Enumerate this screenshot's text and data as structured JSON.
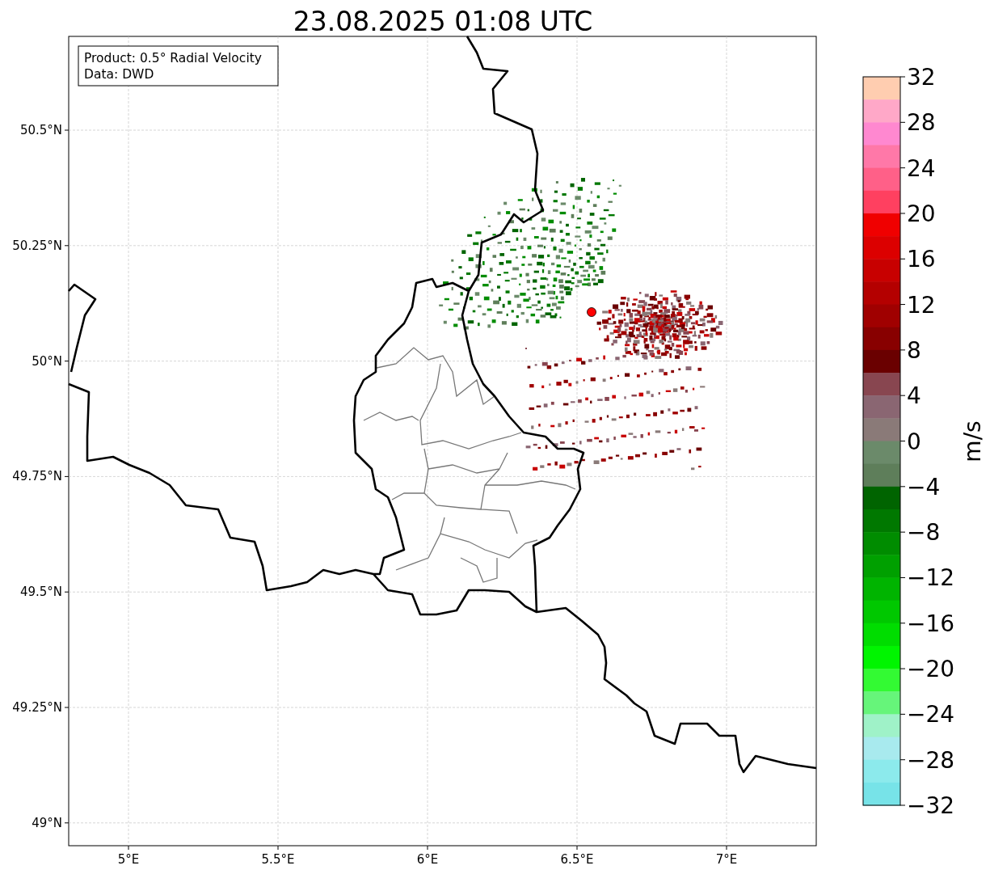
{
  "title": "23.08.2025 01:08 UTC",
  "map": {
    "info_box": [
      "Product: 0.5° Radial Velocity",
      "Data: DWD"
    ],
    "lon_ticks": [
      "5°E",
      "5.5°E",
      "6°E",
      "6.5°E",
      "7°E"
    ],
    "lat_ticks": [
      "50.5°N",
      "50.25°N",
      "50°N",
      "49.75°N",
      "49.5°N",
      "49.25°N",
      "49°N"
    ]
  },
  "colorbar": {
    "label": "m/s",
    "ticks": [
      "32",
      "28",
      "24",
      "20",
      "16",
      "12",
      "8",
      "4",
      "0",
      "−4",
      "−8",
      "−12",
      "−16",
      "−20",
      "−24",
      "−28",
      "−32"
    ],
    "segments": [
      {
        "color": "#ffcdb0"
      },
      {
        "color": "#ffa8c8"
      },
      {
        "color": "#ff88d0"
      },
      {
        "color": "#ff78a8"
      },
      {
        "color": "#ff6088"
      },
      {
        "color": "#ff4060"
      },
      {
        "color": "#f00000"
      },
      {
        "color": "#dc0000"
      },
      {
        "color": "#c80000"
      },
      {
        "color": "#b40000"
      },
      {
        "color": "#a00000"
      },
      {
        "color": "#880000"
      },
      {
        "color": "#6a0000"
      },
      {
        "color": "#884650"
      },
      {
        "color": "#8a6672"
      },
      {
        "color": "#8a7a78"
      },
      {
        "color": "#6b8a6a"
      },
      {
        "color": "#5e7e5a"
      },
      {
        "color": "#006400"
      },
      {
        "color": "#007800"
      },
      {
        "color": "#008c00"
      },
      {
        "color": "#00a000"
      },
      {
        "color": "#00b400"
      },
      {
        "color": "#00c800"
      },
      {
        "color": "#00dd00"
      },
      {
        "color": "#00f500"
      },
      {
        "color": "#33fa33"
      },
      {
        "color": "#66f57a"
      },
      {
        "color": "#9ff2c8"
      },
      {
        "color": "#a8eaee"
      },
      {
        "color": "#8ceaec"
      },
      {
        "color": "#77e3e8"
      }
    ]
  }
}
